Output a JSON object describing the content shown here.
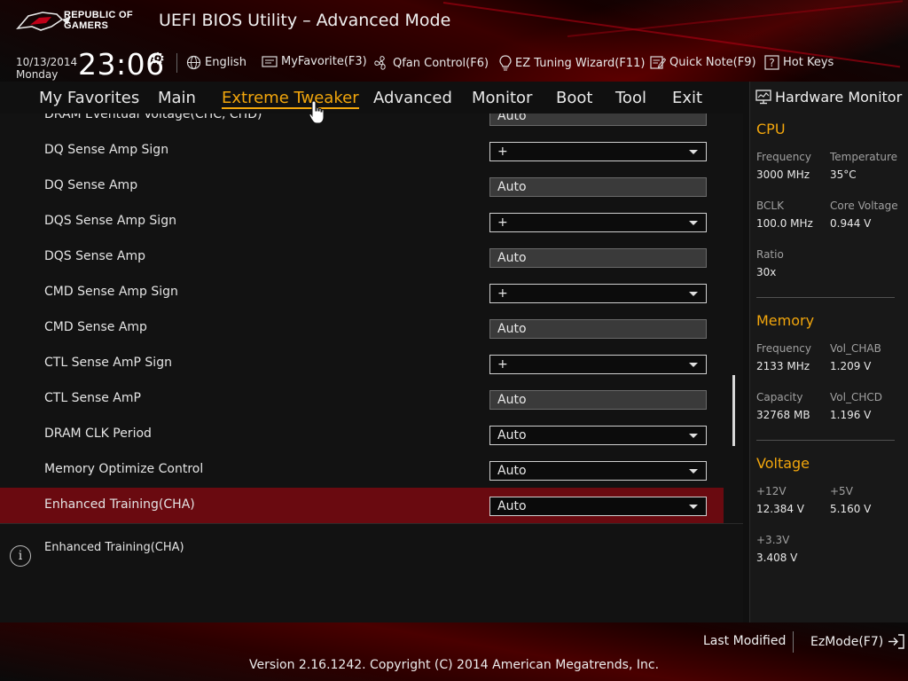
{
  "header": {
    "brand_line1": "REPUBLIC OF",
    "brand_line2": "GAMERS",
    "title": "UEFI BIOS Utility – Advanced Mode",
    "date": "10/13/2014",
    "weekday": "Monday",
    "time": "23:06",
    "toolbar": {
      "language": "English",
      "myfavorite": "MyFavorite(F3)",
      "qfan": "Qfan Control(F6)",
      "ez_tuning": "EZ Tuning Wizard(F11)",
      "quick_note": "Quick Note(F9)",
      "hot_keys": "Hot Keys"
    }
  },
  "nav": {
    "tabs": [
      "My Favorites",
      "Main",
      "Extreme Tweaker",
      "Advanced",
      "Monitor",
      "Boot",
      "Tool",
      "Exit"
    ],
    "active": "Extreme Tweaker"
  },
  "settings": [
    {
      "label": "DRAM Eventual Voltage(CHC, CHD)",
      "value": "Auto",
      "control": "text"
    },
    {
      "label": "DQ Sense Amp Sign",
      "value": "+",
      "control": "dropdown"
    },
    {
      "label": "DQ Sense Amp",
      "value": "Auto",
      "control": "text"
    },
    {
      "label": "DQS Sense Amp Sign",
      "value": "+",
      "control": "dropdown"
    },
    {
      "label": "DQS Sense Amp",
      "value": "Auto",
      "control": "text"
    },
    {
      "label": "CMD Sense Amp Sign",
      "value": "+",
      "control": "dropdown"
    },
    {
      "label": "CMD Sense Amp",
      "value": "Auto",
      "control": "text"
    },
    {
      "label": "CTL Sense AmP Sign",
      "value": "+",
      "control": "dropdown"
    },
    {
      "label": "CTL Sense AmP",
      "value": "Auto",
      "control": "text"
    },
    {
      "label": "DRAM CLK Period",
      "value": "Auto",
      "control": "dropdown"
    },
    {
      "label": "Memory Optimize Control",
      "value": "Auto",
      "control": "dropdown"
    },
    {
      "label": "Enhanced Training(CHA)",
      "value": "Auto",
      "control": "dropdown",
      "selected": true
    }
  ],
  "help": {
    "text": "Enhanced Training(CHA)"
  },
  "hardware_monitor": {
    "title": "Hardware Monitor",
    "cpu": {
      "heading": "CPU",
      "frequency_label": "Frequency",
      "frequency": "3000 MHz",
      "temperature_label": "Temperature",
      "temperature": "35°C",
      "bclk_label": "BCLK",
      "bclk": "100.0 MHz",
      "core_voltage_label": "Core Voltage",
      "core_voltage": "0.944 V",
      "ratio_label": "Ratio",
      "ratio": "30x"
    },
    "memory": {
      "heading": "Memory",
      "frequency_label": "Frequency",
      "frequency": "2133 MHz",
      "vol_chab_label": "Vol_CHAB",
      "vol_chab": "1.209 V",
      "capacity_label": "Capacity",
      "capacity": "32768 MB",
      "vol_chcd_label": "Vol_CHCD",
      "vol_chcd": "1.196 V"
    },
    "voltage": {
      "heading": "Voltage",
      "v12_label": "+12V",
      "v12": "12.384 V",
      "v5_label": "+5V",
      "v5": "5.160 V",
      "v33_label": "+3.3V",
      "v33": "3.408 V"
    }
  },
  "footer": {
    "last_modified": "Last Modified",
    "ezmode": "EzMode(F7)",
    "copyright": "Version 2.16.1242. Copyright (C) 2014 American Megatrends, Inc."
  },
  "colors": {
    "accent": "#f2a60c",
    "selected_row": "#6a0a10",
    "brand_red": "#a00010"
  },
  "icons": [
    "rog-logo",
    "gear-icon",
    "globe-icon",
    "favorite-icon",
    "fan-icon",
    "lightbulb-icon",
    "note-icon",
    "hotkeys-icon",
    "monitor-icon",
    "info-icon",
    "exit-icon",
    "hand-cursor-icon"
  ]
}
